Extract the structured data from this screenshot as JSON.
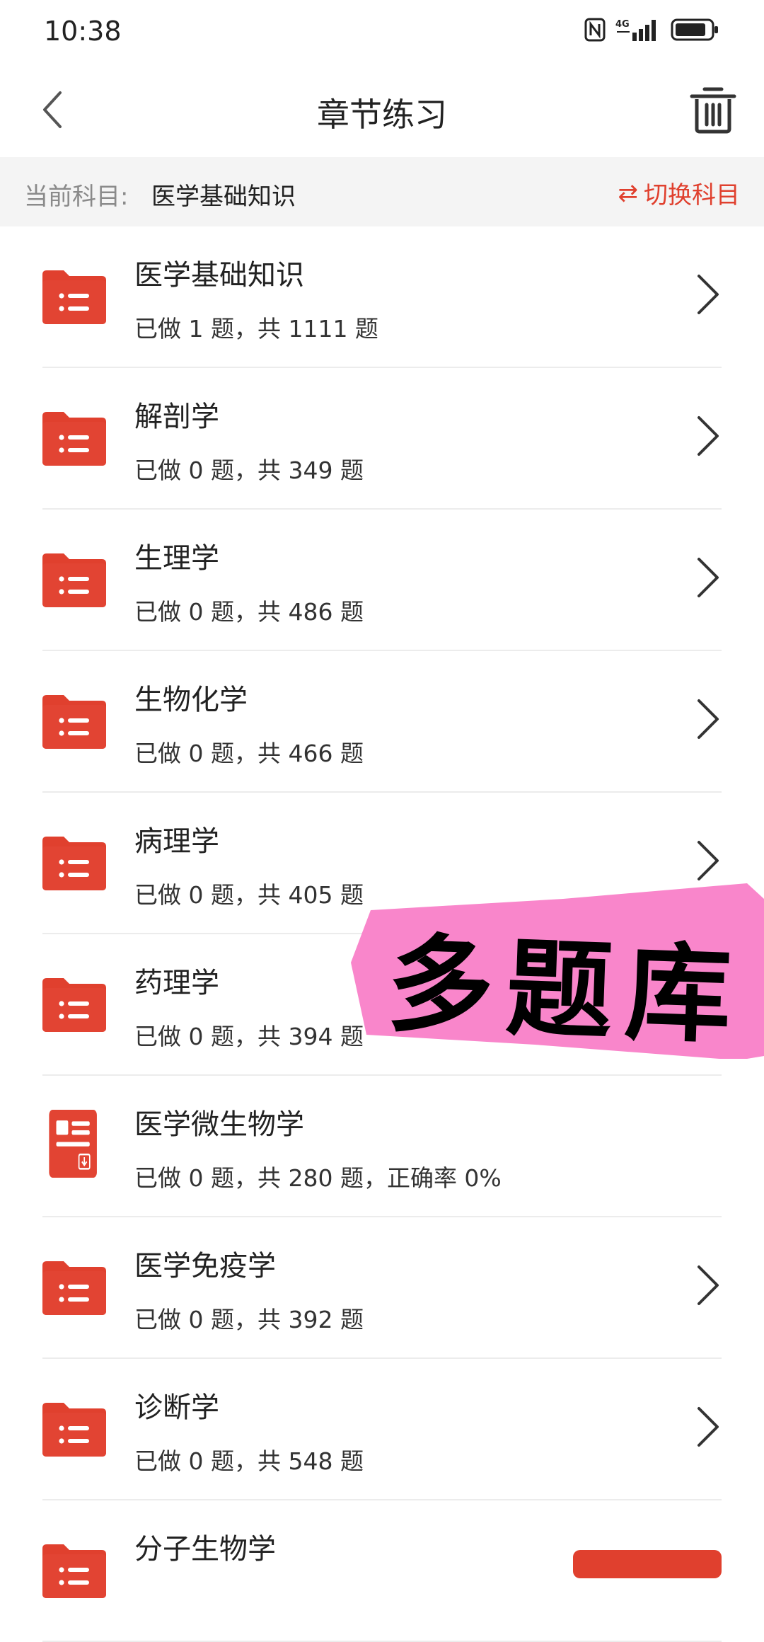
{
  "status_bar": {
    "time": "10:38",
    "network": "4G"
  },
  "header": {
    "title": "章节练习",
    "back_icon": "chevron-left-icon",
    "trash_icon": "trash-icon"
  },
  "subject_bar": {
    "label": "当前科目:",
    "value": "医学基础知识",
    "switch_label": "切换科目",
    "switch_icon": "⇄"
  },
  "chapters": [
    {
      "title": "医学基础知识",
      "subtitle": "已做 1 题，共 1111 题",
      "icon": "folder-list-icon",
      "chevron": true
    },
    {
      "title": "解剖学",
      "subtitle": "已做 0 题，共 349 题",
      "icon": "folder-list-icon",
      "chevron": true
    },
    {
      "title": "生理学",
      "subtitle": "已做 0 题，共 486 题",
      "icon": "folder-list-icon",
      "chevron": true
    },
    {
      "title": "生物化学",
      "subtitle": "已做 0 题，共 466 题",
      "icon": "folder-list-icon",
      "chevron": true
    },
    {
      "title": "病理学",
      "subtitle": "已做 0 题，共 405 题",
      "icon": "folder-list-icon",
      "chevron": true
    },
    {
      "title": "药理学",
      "subtitle": "已做 0 题，共 394 题",
      "icon": "folder-list-icon",
      "chevron": true
    },
    {
      "title": "医学微生物学",
      "subtitle": "已做 0 题，共 280 题，正确率 0%",
      "icon": "document-icon",
      "chevron": false
    },
    {
      "title": "医学免疫学",
      "subtitle": "已做 0 题，共 392 题",
      "icon": "folder-list-icon",
      "chevron": true
    },
    {
      "title": "诊断学",
      "subtitle": "已做 0 题，共 548 题",
      "icon": "folder-list-icon",
      "chevron": true
    },
    {
      "title": "分子生物学",
      "subtitle": "",
      "icon": "folder-list-icon",
      "chevron": false
    }
  ],
  "sticker": {
    "text": "多题库"
  },
  "colors": {
    "accent": "#e0402e",
    "sticker_bg": "#f986cb",
    "subject_bar_bg": "#f4f4f4"
  }
}
